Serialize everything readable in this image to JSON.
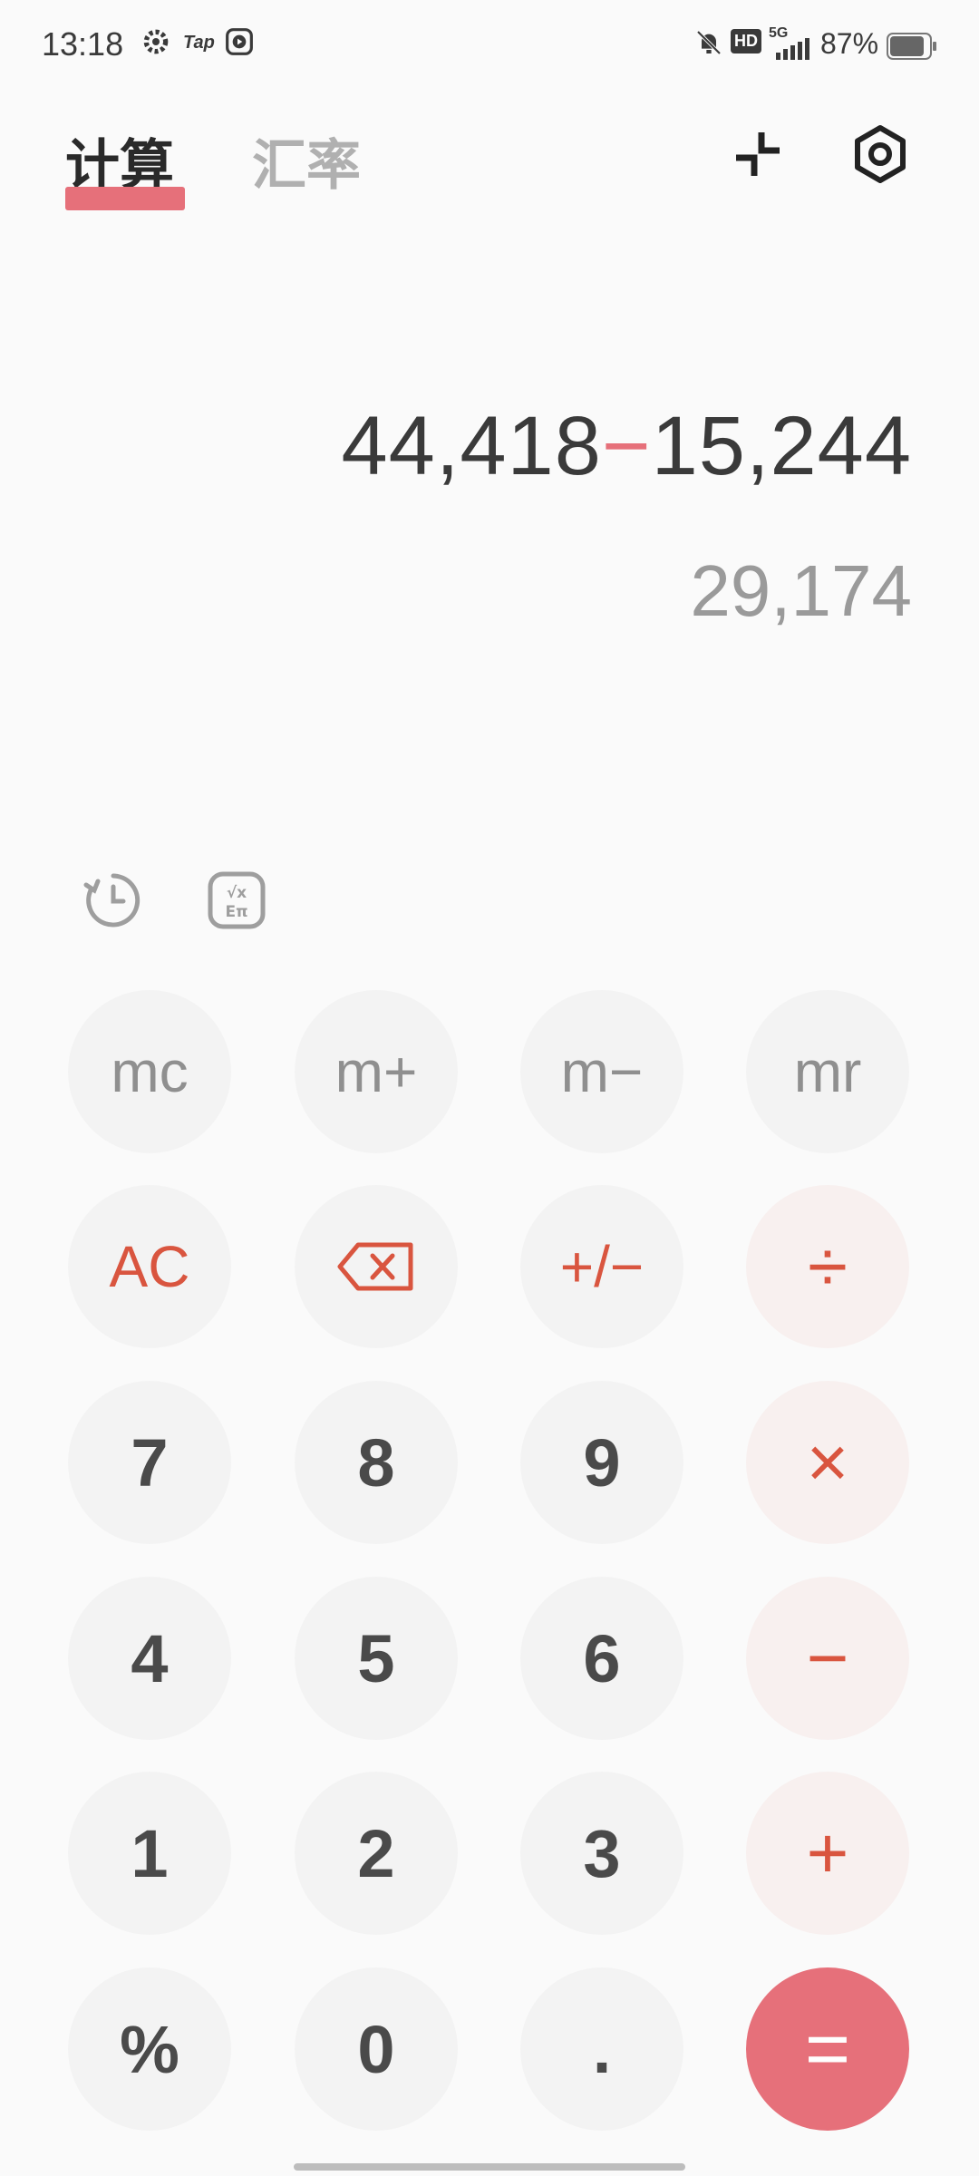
{
  "status_bar": {
    "time": "13:18",
    "tap_label": "Tap",
    "network": "5G",
    "hd": "HD",
    "battery": "87%",
    "icons": [
      "settings-gear-icon",
      "taptap-app-icon",
      "media-play-icon",
      "bell-muted-icon",
      "hd-icon",
      "signal-5g-icon",
      "battery-icon"
    ]
  },
  "tabs": {
    "calculate": "计算",
    "exchange_rate": "汇率"
  },
  "toolbar": {
    "icons": [
      "collapse-icon",
      "settings-hexagon-icon"
    ]
  },
  "display": {
    "operand1": "44,418",
    "operator": "−",
    "operand2": "15,244",
    "result": "29,174"
  },
  "tools": {
    "icons": [
      "history-icon",
      "scientific-mode-icon"
    ]
  },
  "keys": {
    "mc": "mc",
    "m_plus": "m+",
    "m_minus": "m−",
    "mr": "mr",
    "ac": "AC",
    "plus_minus": "+/−",
    "divide": "÷",
    "seven": "7",
    "eight": "8",
    "nine": "9",
    "multiply": "×",
    "four": "4",
    "five": "5",
    "six": "6",
    "minus": "−",
    "one": "1",
    "two": "2",
    "three": "3",
    "plus": "+",
    "percent": "%",
    "zero": "0",
    "decimal": ".",
    "equals": "="
  },
  "colors": {
    "accent": "#e6707a",
    "operator": "#d9553f",
    "key_bg": "#f3f3f3",
    "op_key_bg": "#f8f0ef"
  }
}
